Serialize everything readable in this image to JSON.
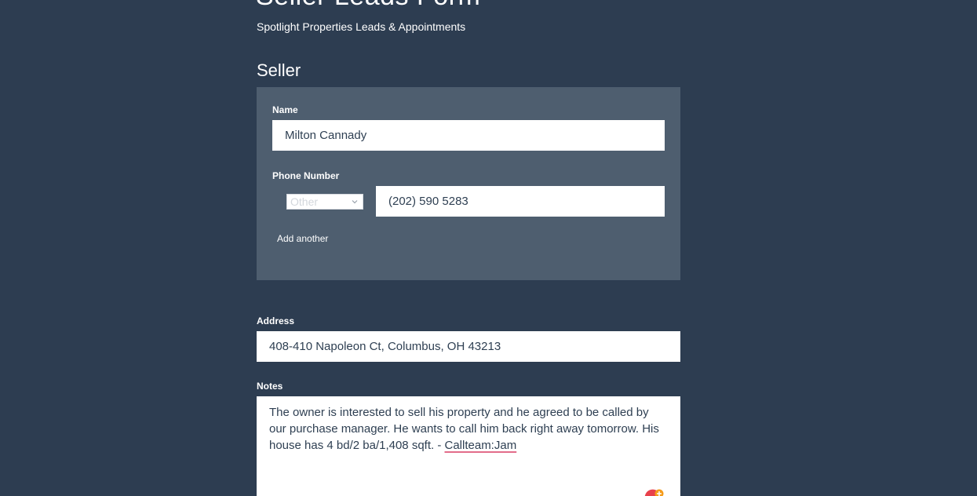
{
  "header": {
    "title": "Seller Leads Form",
    "subtitle": "Spotlight Properties Leads & Appointments"
  },
  "seller": {
    "section_title": "Seller",
    "name_label": "Name",
    "name_value": "Milton Cannady",
    "phone_label": "Phone Number",
    "phone_type_selected": "Other",
    "phone_value": "(202) 590 5283",
    "add_another_label": "Add another"
  },
  "address": {
    "label": "Address",
    "value": "408-410 Napoleon Ct, Columbus, OH 43213"
  },
  "notes": {
    "label": "Notes",
    "text_before": "The owner is interested to sell his property and he agreed to be called by our purchase manager. He wants to call him back right away tomorrow. His house has 4 bd/2 ba/1,408 sqft. - ",
    "text_flagged": "Callteam:Jam"
  },
  "colors": {
    "background": "#2d3d51",
    "panel": "#4e5e6f",
    "input_text": "#2e3f52",
    "spellcheck_underline": "#e36d8a"
  },
  "icons": {
    "phone_type_dropdown": "chevron-down-icon",
    "notes_extension": "grammarly-icon"
  }
}
